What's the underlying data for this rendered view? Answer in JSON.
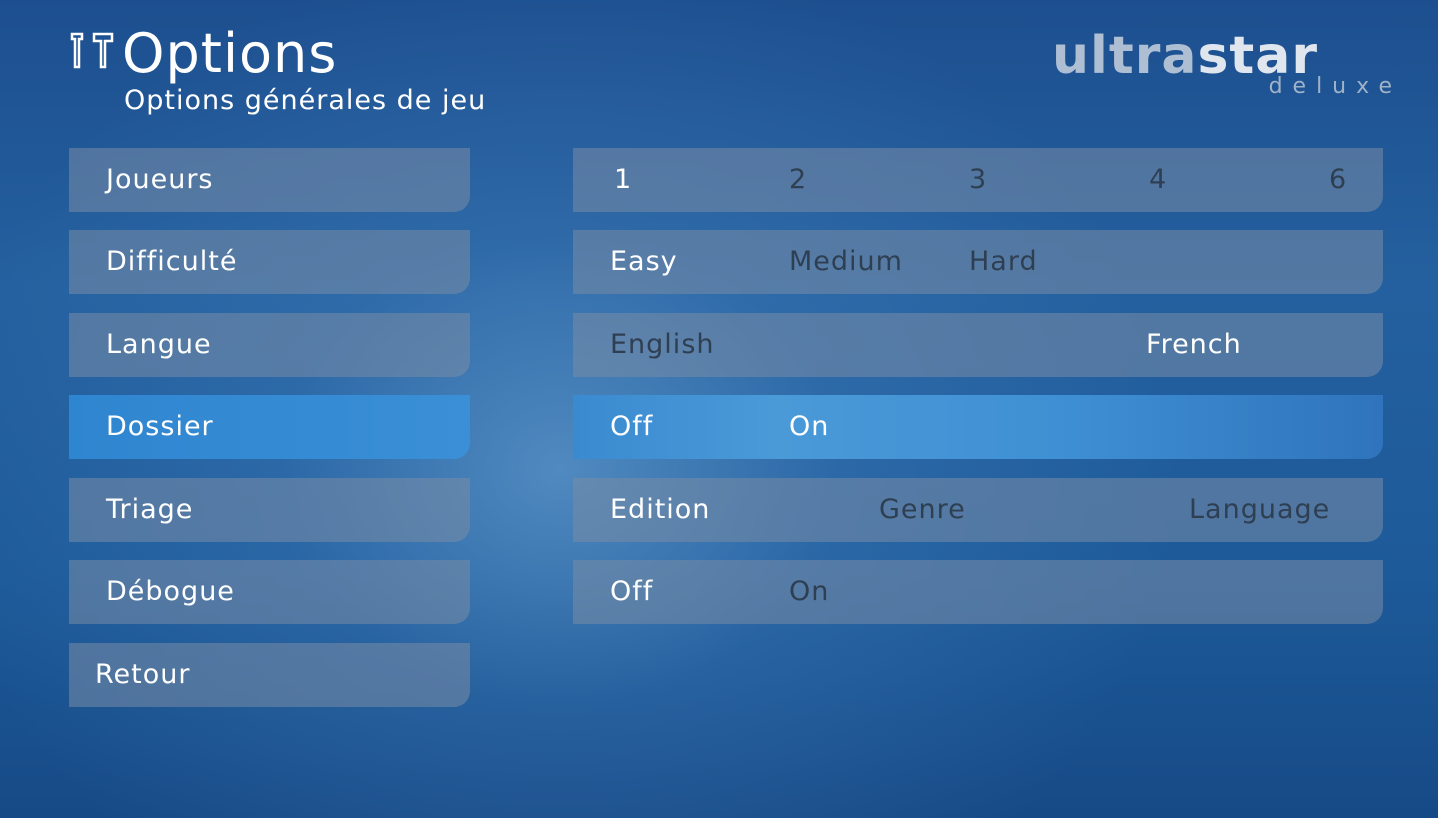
{
  "header": {
    "title": "Options",
    "subtitle": "Options générales de jeu",
    "title_icon": "tools-icon"
  },
  "logo": {
    "part1": "ultra",
    "part2": "star",
    "sub": "deluxe"
  },
  "options": [
    {
      "label": "Joueurs",
      "values": [
        "1",
        "2",
        "3",
        "4",
        "6"
      ],
      "active_index": 0,
      "selected": false
    },
    {
      "label": "Difficulté",
      "values": [
        "Easy",
        "Medium",
        "Hard"
      ],
      "active_index": 0,
      "selected": false
    },
    {
      "label": "Langue",
      "values": [
        "English",
        "French"
      ],
      "active_index": 0,
      "selected": false
    },
    {
      "label": "Dossier",
      "values": [
        "Off",
        "On"
      ],
      "active_index": 0,
      "selected": true
    },
    {
      "label": "Triage",
      "values": [
        "Edition",
        "Genre",
        "Language"
      ],
      "active_index": 0,
      "selected": false
    },
    {
      "label": "Débogue",
      "values": [
        "Off",
        "On"
      ],
      "active_index": 0,
      "selected": false
    }
  ],
  "back_button": "Retour",
  "colors": {
    "selected_accent": "#3a8fd6",
    "row_background": "#788ca5",
    "inactive_value": "#2f3f52",
    "active_value": "#ffffff"
  }
}
